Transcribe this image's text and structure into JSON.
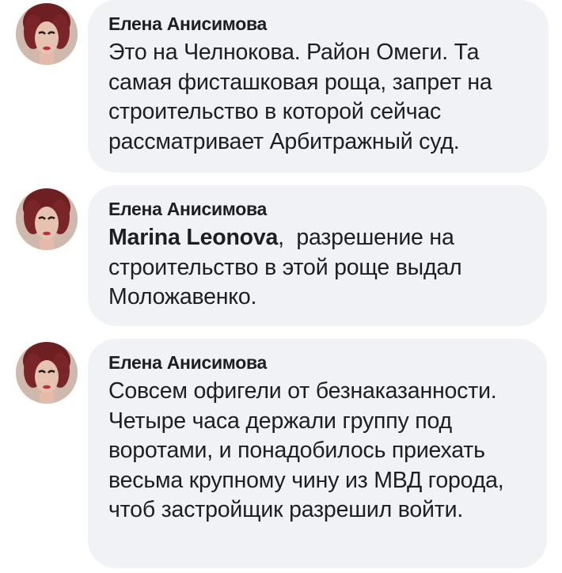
{
  "comments": [
    {
      "author": "Елена Анисимова",
      "mention": "",
      "text": "Это на Челнокова. Район Омеги. Та самая фисташковая роща, запрет на строительство в которой сейчас рассматривает Арбитражный суд."
    },
    {
      "author": "Елена Анисимова",
      "mention": "Marina Leonova",
      "text": ",  разрешение на строительство в этой роще выдал Моложавенко."
    },
    {
      "author": "Елена Анисимова",
      "mention": "",
      "text": "Совсем офигели от безнаказанности. Четыре часа держали группу под воротами, и понадобилось приехать весьма крупному чину из МВД города, чтоб застройщик разрешил войти."
    }
  ],
  "colors": {
    "bubble_background": "#f0f2f5",
    "text": "#1c1e21"
  },
  "icons": {
    "avatar": "profile-photo-avatar"
  }
}
